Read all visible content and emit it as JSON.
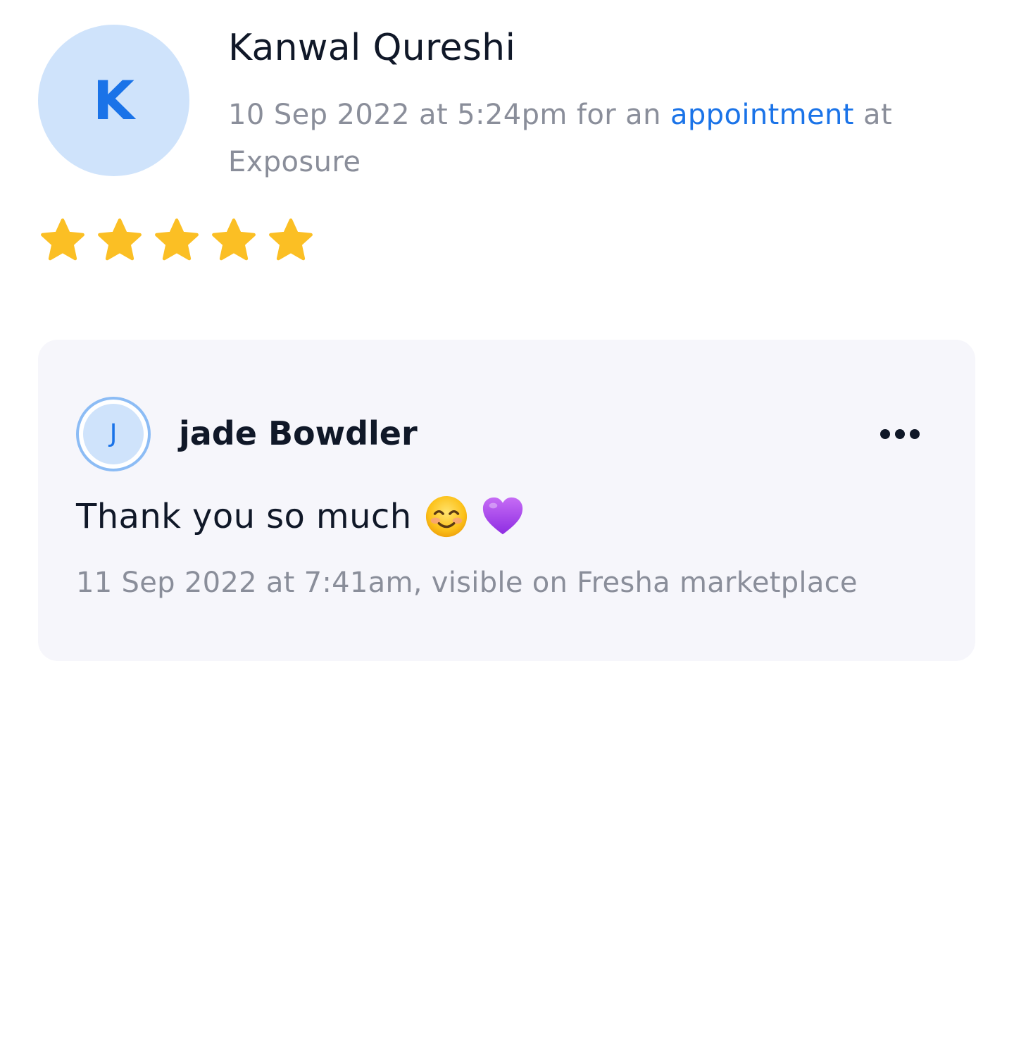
{
  "review": {
    "reviewer": {
      "initial": "K",
      "name": "Kanwal Qureshi"
    },
    "meta": {
      "date_time": "10 Sep 2022 at 5:24pm",
      "pre_link": "for an",
      "link_label": "appointment",
      "post_link": "at",
      "location": "Exposure"
    },
    "rating": {
      "value": 5,
      "max": 5,
      "star_color": "#fbbf24"
    }
  },
  "reply": {
    "replier": {
      "initial": "J",
      "name": "jade Bowdler"
    },
    "more_icon": "more-horizontal-icon",
    "text": "Thank you so much",
    "emojis": [
      "smiling-face-emoji",
      "purple-heart-emoji"
    ],
    "meta": "11 Sep 2022 at 7:41am, visible on Fresha marketplace"
  },
  "colors": {
    "accent": "#1a73e8",
    "avatar_bg": "#cfe3fb",
    "card_bg": "#f6f6fb",
    "muted_text": "#8a8e9a",
    "primary_text": "#101828"
  }
}
